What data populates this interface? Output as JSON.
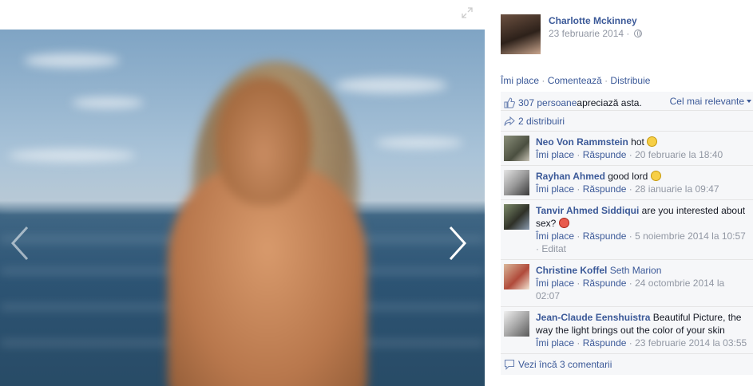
{
  "viewer": {
    "photo_alt": "Photo",
    "prev_label": "‹",
    "next_label": "›"
  },
  "post": {
    "author": "Charlotte Mckinney",
    "date": "23 februarie 2014 · ",
    "actions": {
      "like": "Îmi place",
      "comment": "Comentează",
      "share": "Distribuie",
      "sep": " · "
    },
    "likes": {
      "count_link": "307 persoane",
      "suffix": " apreciază asta.",
      "sort": "Cel mai relevante"
    },
    "shares": "2 distribuiri",
    "comments": [
      {
        "author": "Neo Von Rammstein",
        "text": " hot ",
        "emoji": "smile",
        "like": "Îmi place",
        "reply": "Răspunde",
        "meta": " · 20 februarie la 18:40"
      },
      {
        "author": "Rayhan Ahmed",
        "text": " good lord ",
        "emoji": "surprised",
        "like": "Îmi place",
        "reply": "Răspunde",
        "meta": " · 28 ianuarie la 09:47"
      },
      {
        "author": "Tanvir Ahmed Siddiqui",
        "text": " are you interested about sex? ",
        "emoji": "devil",
        "like": "Îmi place",
        "reply": "Răspunde",
        "meta": " · 5 noiembrie 2014 la 10:57 · Editat"
      },
      {
        "author": "Christine Koffel",
        "mention": "Seth Marion",
        "like": "Îmi place",
        "reply": "Răspunde",
        "meta": " · 24 octombrie 2014 la 02:07"
      },
      {
        "author": "Jean-Claude Eenshuistra",
        "text": " Beautiful Picture, the way the light brings out the color of your skin",
        "like": "Îmi place",
        "reply": "Răspunde",
        "meta": " · 23 februarie 2014 la 03:55"
      }
    ],
    "more_comments": "Vezi încă 3 comentarii"
  },
  "colors": {
    "link": "#3b5998",
    "meta": "#9197a3",
    "ufi_bg": "#f6f7f9"
  },
  "icons": [
    "expand-icon",
    "chevron-left-icon",
    "chevron-right-icon",
    "globe-icon",
    "thumbs-up-icon",
    "share-icon",
    "comment-icon"
  ]
}
